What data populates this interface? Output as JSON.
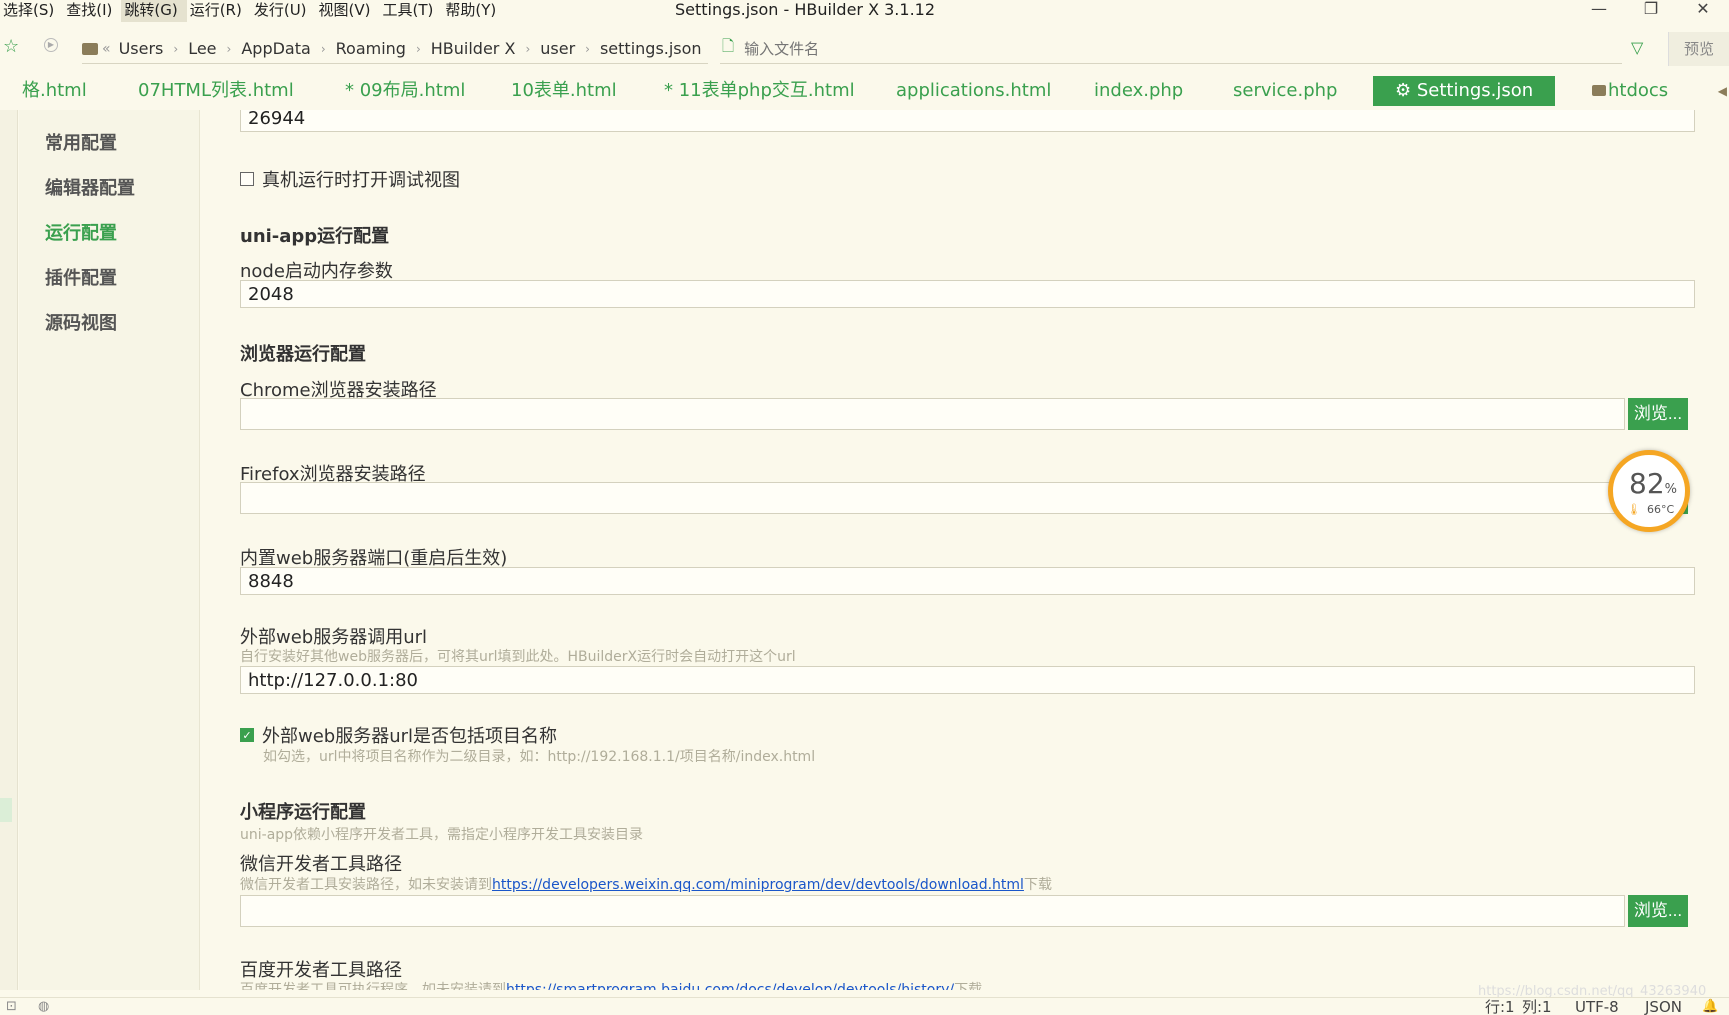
{
  "menu": {
    "items": [
      "选择(S)",
      "查找(I)",
      "跳转(G)",
      "运行(R)",
      "发行(U)",
      "视图(V)",
      "工具(T)",
      "帮助(Y)"
    ],
    "active_index": 2
  },
  "window": {
    "title": "Settings.json - HBuilder X 3.1.12",
    "minimize": "—",
    "maximize": "❐",
    "close": "✕"
  },
  "breadcrumb": {
    "back": "«",
    "items": [
      "Users",
      "Lee",
      "AppData",
      "Roaming",
      "HBuilder X",
      "user",
      "settings.json"
    ],
    "separator": "›"
  },
  "file_search": {
    "placeholder": "输入文件名"
  },
  "preview_label": "预览",
  "tabs": [
    {
      "label": "格.html",
      "active": false
    },
    {
      "label": "07HTML列表.html",
      "active": false
    },
    {
      "label": "* 09布局.html",
      "active": false
    },
    {
      "label": "10表单.html",
      "active": false
    },
    {
      "label": "* 11表单php交互.html",
      "active": false
    },
    {
      "label": "applications.html",
      "active": false
    },
    {
      "label": "index.php",
      "active": false
    },
    {
      "label": "service.php",
      "active": false
    },
    {
      "label": "⚙ Settings.json",
      "active": true
    },
    {
      "label": "htdocs",
      "active": false
    }
  ],
  "settings_nav": [
    {
      "label": "常用配置",
      "active": false
    },
    {
      "label": "编辑器配置",
      "active": false
    },
    {
      "label": "运行配置",
      "active": true
    },
    {
      "label": "插件配置",
      "active": false
    },
    {
      "label": "源码视图",
      "active": false
    }
  ],
  "content": {
    "top_value": "26944",
    "debug_checkbox": {
      "label": "真机运行时打开调试视图",
      "checked": false
    },
    "uniapp": {
      "title": "uni-app运行配置",
      "node_label": "node启动内存参数",
      "node_value": "2048"
    },
    "browser": {
      "title": "浏览器运行配置",
      "chrome_label": "Chrome浏览器安装路径",
      "chrome_value": "",
      "firefox_label": "Firefox浏览器安装路径",
      "firefox_value": "",
      "browse_label": "浏览..."
    },
    "web_server": {
      "port_label": "内置web服务器端口(重启后生效)",
      "port_value": "8848",
      "url_label": "外部web服务器调用url",
      "url_hint": "自行安装好其他web服务器后，可将其url填到此处。HBuilderX运行时会自动打开这个url",
      "url_value": "http://127.0.0.1:80",
      "include_project": {
        "label": "外部web服务器url是否包括项目名称",
        "checked": true
      },
      "include_hint": "如勾选，url中将项目名称作为二级目录，如：http://192.168.1.1/项目名称/index.html"
    },
    "miniprogram": {
      "title": "小程序运行配置",
      "hint": "uni-app依赖小程序开发者工具，需指定小程序开发工具安装目录",
      "wechat_label": "微信开发者工具路径",
      "wechat_hint_prefix": "微信开发者工具安装路径，如未安装请到",
      "wechat_link": "https://developers.weixin.qq.com/miniprogram/dev/devtools/download.html",
      "wechat_hint_suffix": "下载",
      "wechat_value": "",
      "baidu_label": "百度开发者工具路径",
      "baidu_hint_prefix": "百度开发者工具可执行程序，如未安装请到",
      "baidu_link": "https://smartprogram.baidu.com/docs/develop/devtools/history/",
      "baidu_hint_suffix": "下载"
    }
  },
  "perf": {
    "percent": "82",
    "percent_unit": "%",
    "temp": "66°C"
  },
  "status": {
    "line": "行:1",
    "col": "列:1",
    "encoding": "UTF-8",
    "language": "JSON"
  },
  "watermark": "https://blog.csdn.net/qq_43263940"
}
